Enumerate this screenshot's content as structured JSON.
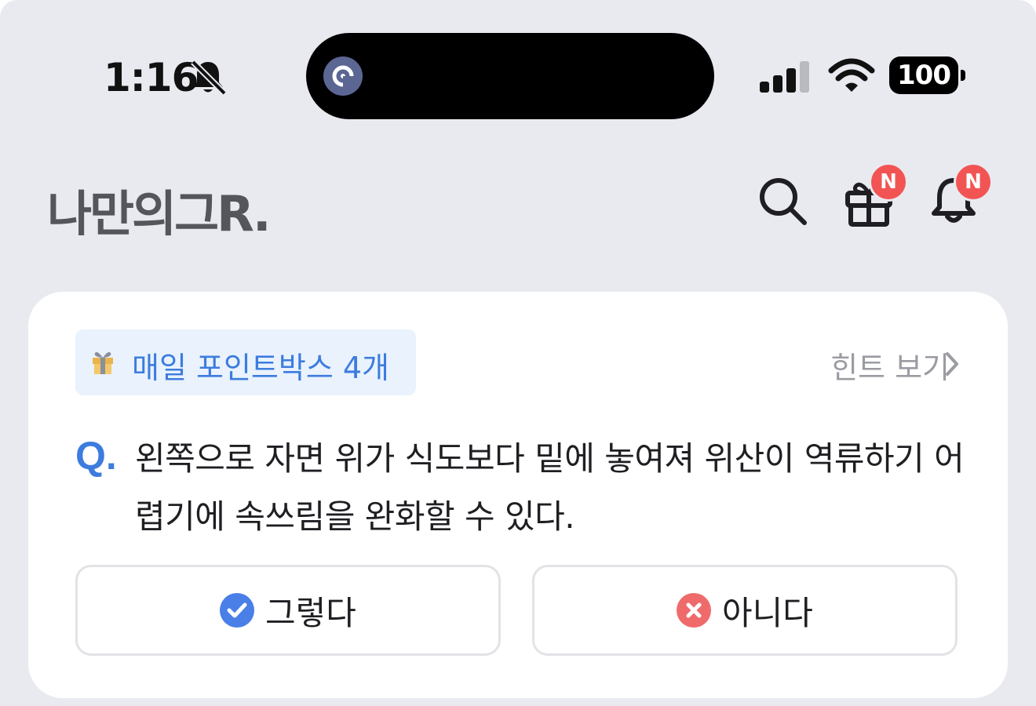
{
  "status_bar": {
    "time": "1:16",
    "battery": "100",
    "icons": [
      "bell-slash-icon",
      "signal-icon",
      "wifi-icon",
      "battery-icon"
    ]
  },
  "header": {
    "logo": "나만의그R.",
    "icons": [
      "search-icon",
      "gift-icon",
      "bell-icon"
    ],
    "gift_badge": "N",
    "bell_badge": "N",
    "badge_color": "#f25454"
  },
  "quiz_card": {
    "points_label": "매일 포인트박스 4개",
    "hint_label": "힌트 보기",
    "q_mark": "Q.",
    "question": "왼쪽으로 자면 위가 식도보다 밑에 놓여져 위산이 역류하기 어렵기에 속쓰림을 완화할 수 있다.",
    "yes_label": "그렇다",
    "no_label": "아니다",
    "accent_color": "#3d7cde",
    "yes_icon_color": "#4a7fe8",
    "no_icon_color": "#ef6b6b"
  }
}
